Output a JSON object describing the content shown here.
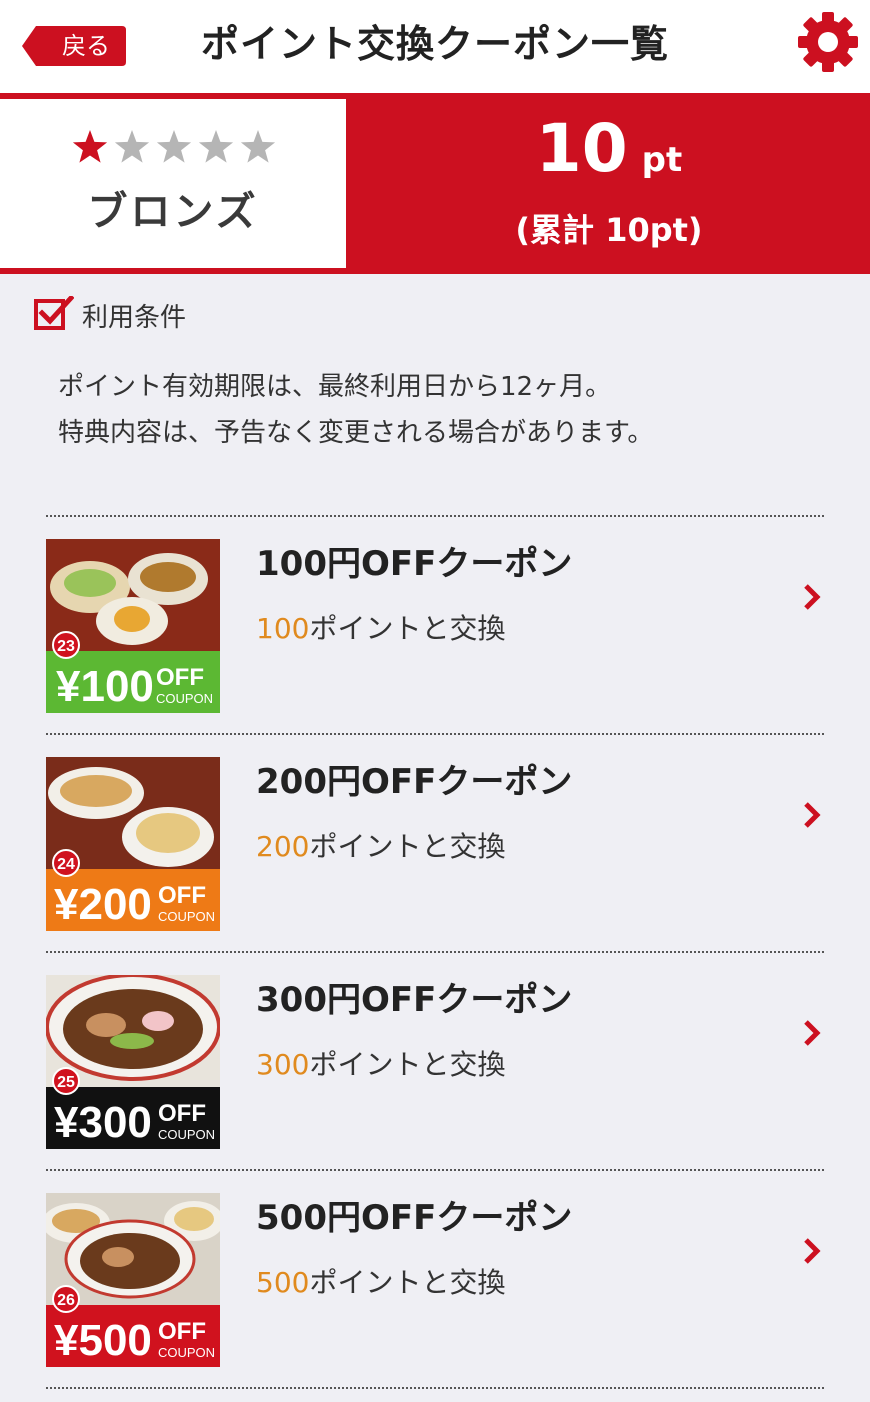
{
  "header": {
    "back_label": "戻る",
    "title": "ポイント交換クーポン一覧",
    "settings_icon": "gear-icon"
  },
  "status": {
    "stars_filled": 1,
    "stars_total": 5,
    "rank_name": "ブロンズ",
    "points_value": "10",
    "points_unit": "pt",
    "points_total": "(累計 10pt)"
  },
  "terms": {
    "title": "利用条件",
    "line1": "ポイント有効期限は、最終利用日から12ヶ月。",
    "line2": "特典内容は、予告なく変更される場合があります。"
  },
  "coupons": [
    {
      "title": "100円OFFクーポン",
      "cost_points": "100",
      "cost_suffix": "ポイントと交換",
      "badge_number": "23",
      "banner_amount": "¥100",
      "banner_off": "OFF",
      "banner_coupon": "COUPON",
      "banner_color": "#5cb833"
    },
    {
      "title": "200円OFFクーポン",
      "cost_points": "200",
      "cost_suffix": "ポイントと交換",
      "badge_number": "24",
      "banner_amount": "¥200",
      "banner_off": "OFF",
      "banner_coupon": "COUPON",
      "banner_color": "#ee7a16"
    },
    {
      "title": "300円OFFクーポン",
      "cost_points": "300",
      "cost_suffix": "ポイントと交換",
      "badge_number": "25",
      "banner_amount": "¥300",
      "banner_off": "OFF",
      "banner_coupon": "COUPON",
      "banner_color": "#111111"
    },
    {
      "title": "500円OFFクーポン",
      "cost_points": "500",
      "cost_suffix": "ポイントと交換",
      "badge_number": "26",
      "banner_amount": "¥500",
      "banner_off": "OFF",
      "banner_coupon": "COUPON",
      "banner_color": "#d0121e"
    }
  ],
  "colors": {
    "brand_red": "#cc1020",
    "cost_orange": "#e08a1e",
    "star_inactive": "#b5b5b5"
  }
}
